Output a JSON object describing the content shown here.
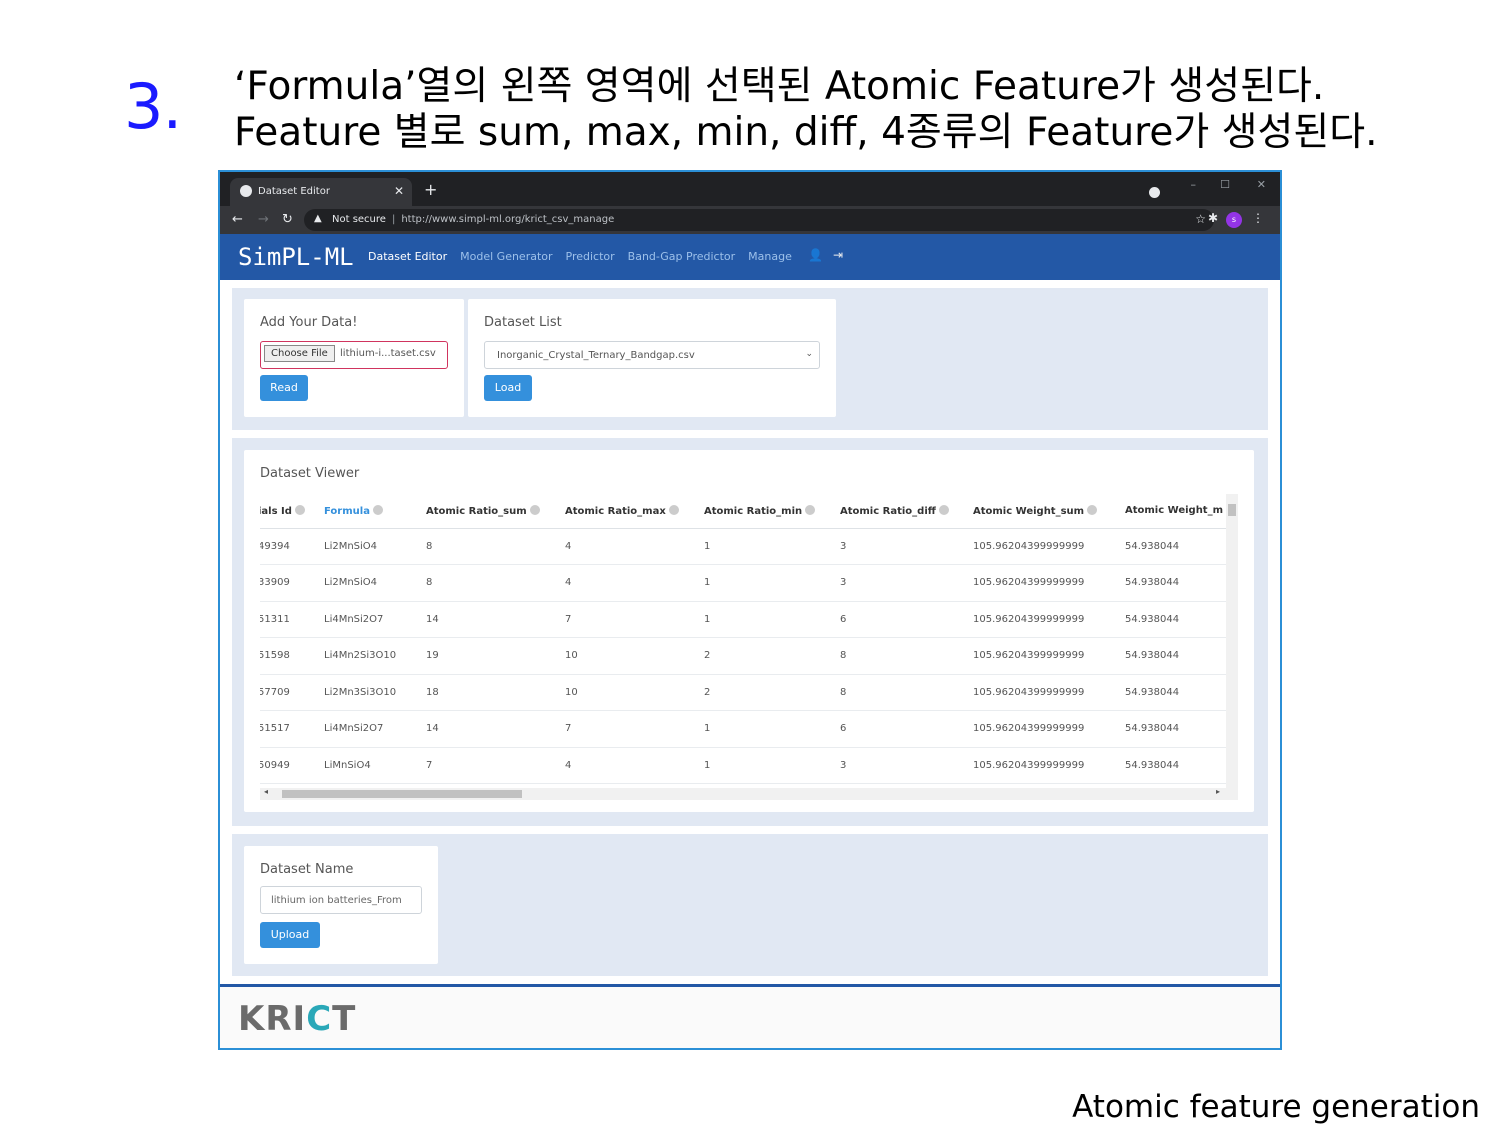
{
  "slide": {
    "step_number": "3.",
    "line1": "‘Formula’열의 왼쪽 영역에 선택된 Atomic Feature가 생성된다.",
    "line2": "Feature 별로 sum, max, min, diff, 4종류의 Feature가 생성된다.",
    "caption": "Atomic feature generation"
  },
  "browser": {
    "tab_title": "Dataset Editor",
    "security": "Not secure",
    "url": "http://www.simpl-ml.org/krict_csv_manage",
    "profile_initial": "s"
  },
  "navbar": {
    "logo": "SimPL-ML",
    "links": [
      "Dataset Editor",
      "Model Generator",
      "Predictor",
      "Band-Gap Predictor",
      "Manage"
    ]
  },
  "add_data": {
    "title": "Add Your Data!",
    "choose_file": "Choose File",
    "file_name": "lithium-i...taset.csv",
    "read_button": "Read"
  },
  "dataset_list": {
    "title": "Dataset List",
    "selected": "Inorganic_Crystal_Ternary_Bandgap.csv",
    "load_button": "Load"
  },
  "viewer": {
    "title": "Dataset Viewer",
    "columns": [
      "ials Id",
      "Formula",
      "Atomic Ratio_sum",
      "Atomic Ratio_max",
      "Atomic Ratio_min",
      "Atomic Ratio_diff",
      "Atomic Weight_sum",
      "Atomic Weight_m"
    ],
    "rows": [
      [
        "49394",
        "Li2MnSiO4",
        "8",
        "4",
        "1",
        "3",
        "105.96204399999999",
        "54.938044"
      ],
      [
        "33909",
        "Li2MnSiO4",
        "8",
        "4",
        "1",
        "3",
        "105.96204399999999",
        "54.938044"
      ],
      [
        "51311",
        "Li4MnSi2O7",
        "14",
        "7",
        "1",
        "6",
        "105.96204399999999",
        "54.938044"
      ],
      [
        "51598",
        "Li4Mn2Si3O10",
        "19",
        "10",
        "2",
        "8",
        "105.96204399999999",
        "54.938044"
      ],
      [
        "57709",
        "Li2Mn3Si3O10",
        "18",
        "10",
        "2",
        "8",
        "105.96204399999999",
        "54.938044"
      ],
      [
        "51517",
        "Li4MnSi2O7",
        "14",
        "7",
        "1",
        "6",
        "105.96204399999999",
        "54.938044"
      ],
      [
        "50949",
        "LiMnSiO4",
        "7",
        "4",
        "1",
        "3",
        "105.96204399999999",
        "54.938044"
      ]
    ]
  },
  "dataset_name": {
    "title": "Dataset Name",
    "value": "lithium ion batteries_From",
    "upload_button": "Upload"
  },
  "footer": {
    "logo_a": "KRI",
    "logo_b": "C",
    "logo_c": "T"
  }
}
